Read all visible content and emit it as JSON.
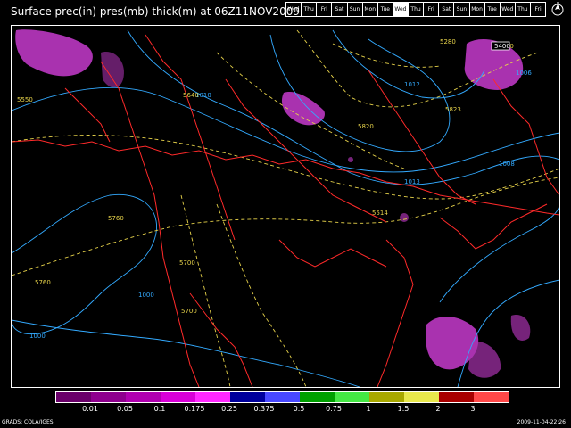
{
  "header": {
    "title": "Surface prec(in) pres(mb) thick(m) at 06Z11NOV2009"
  },
  "timebar": {
    "days": [
      "Wed",
      "Thu",
      "Fri",
      "Sat",
      "Sun",
      "Mon",
      "Tue",
      "Wed",
      "Thu",
      "Fri",
      "Sat",
      "Sun",
      "Mon",
      "Tue",
      "Wed",
      "Thu",
      "Fri"
    ],
    "active_label": "Wed 11"
  },
  "legend": {
    "ticks": [
      "0.01",
      "0.05",
      "0.1",
      "0.175",
      "0.25",
      "0.375",
      "0.5",
      "0.75",
      "1",
      "1.5",
      "2",
      "3"
    ],
    "colors": [
      "#6a006a",
      "#8e008e",
      "#b000b0",
      "#d800d8",
      "#ff28ff",
      "#00009c",
      "#4848ff",
      "#00a000",
      "#44e844",
      "#a8a800",
      "#e8e84c",
      "#a80000",
      "#ff4848"
    ]
  },
  "contour_labels": {
    "pressure": [
      "1010",
      "1012",
      "1013",
      "1008",
      "1000",
      "1000",
      "1006"
    ],
    "thickness": [
      "5550",
      "5640",
      "5820",
      "5823",
      "5280",
      "5400",
      "5760",
      "5700",
      "5700",
      "5760",
      "5514"
    ],
    "high_marker": "5400"
  },
  "footer": {
    "left": "GRADS: COLA/IGES",
    "right": "2009-11-04-22:26"
  },
  "colors": {
    "coast": "#ff2a2a",
    "isobar": "#33aaff",
    "thickness": "#e6d24a",
    "precip": "#c83ccf"
  }
}
